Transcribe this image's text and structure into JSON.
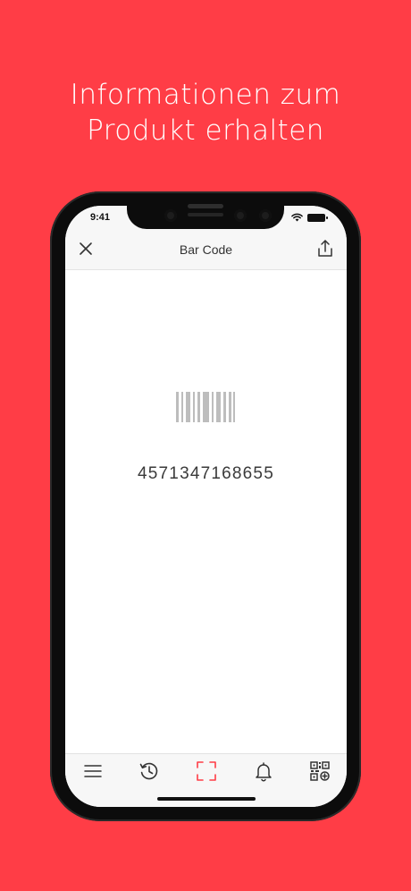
{
  "promo": {
    "headline_line1": "Informationen zum",
    "headline_line2": "Produkt erhalten",
    "background_color": "#FF3D46"
  },
  "status_bar": {
    "time": "9:41"
  },
  "nav_bar": {
    "title": "Bar Code",
    "left_icon": "close-icon",
    "right_icon": "share-icon"
  },
  "content": {
    "barcode_icon": "barcode-icon",
    "barcode_value": "4571347168655"
  },
  "tab_bar": {
    "items": [
      {
        "icon": "menu-icon",
        "active": false
      },
      {
        "icon": "history-icon",
        "active": false
      },
      {
        "icon": "scan-icon",
        "active": true
      },
      {
        "icon": "bell-icon",
        "active": false
      },
      {
        "icon": "qr-generate-icon",
        "active": false
      }
    ],
    "active_color": "#FF3D46",
    "inactive_color": "#333333"
  }
}
